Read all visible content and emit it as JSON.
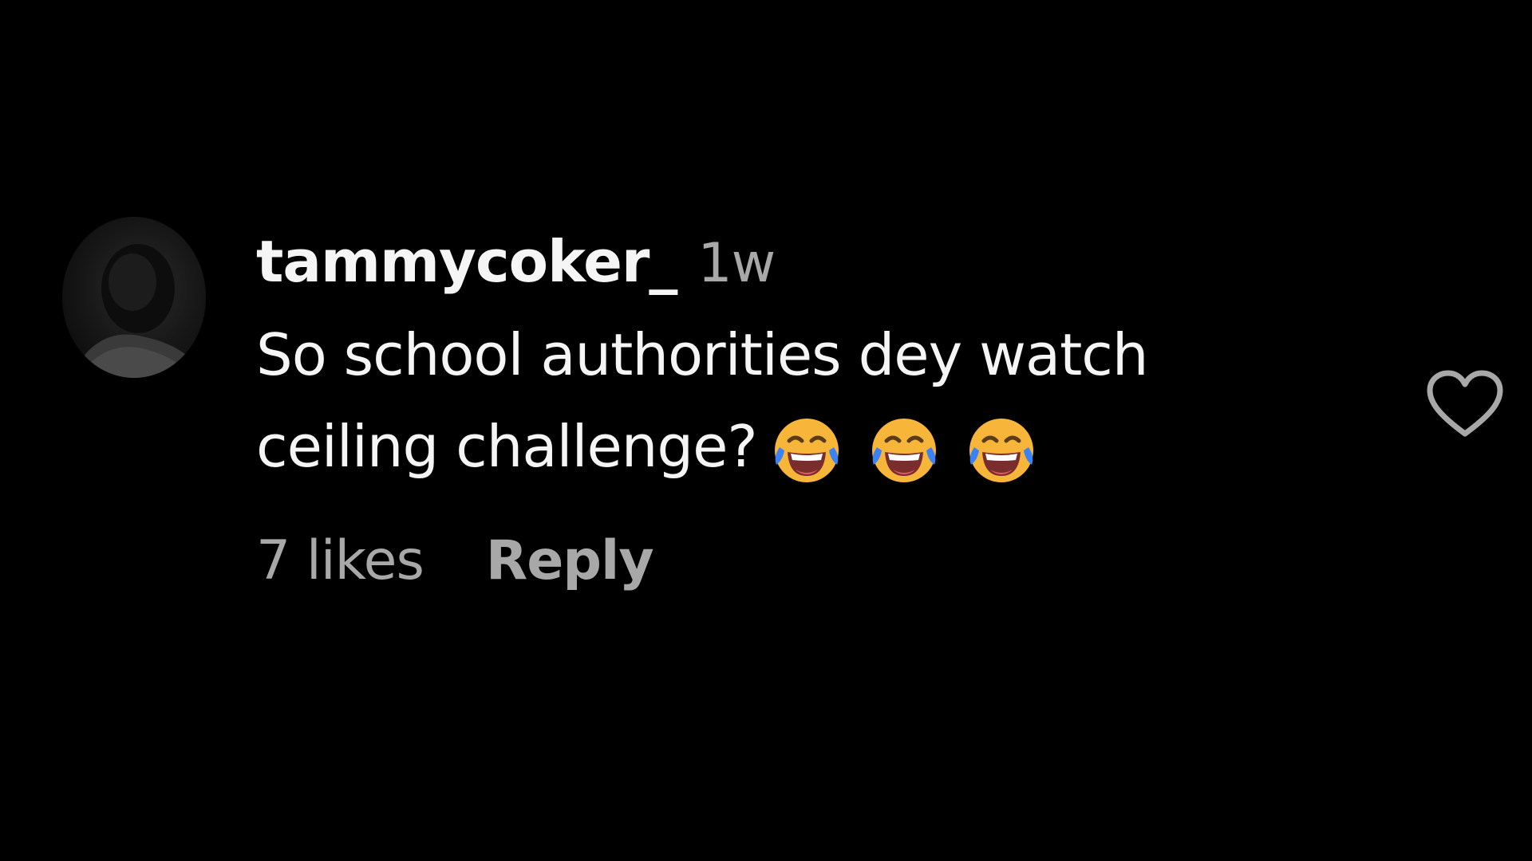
{
  "comment": {
    "username": "tammycoker_",
    "timestamp": "1w",
    "text": "So school authorities dey watch ceiling challenge?",
    "emojis": [
      "face-with-tears-of-joy",
      "face-with-tears-of-joy",
      "face-with-tears-of-joy"
    ],
    "likes_label": "7 likes",
    "reply_label": "Reply",
    "like_icon": "heart-outline-icon"
  },
  "colors": {
    "background": "#000000",
    "primary_text": "#f5f5f5",
    "secondary_text": "#a8a8a8",
    "emoji_face": "#f7b53a",
    "emoji_tears": "#3b82f6"
  }
}
